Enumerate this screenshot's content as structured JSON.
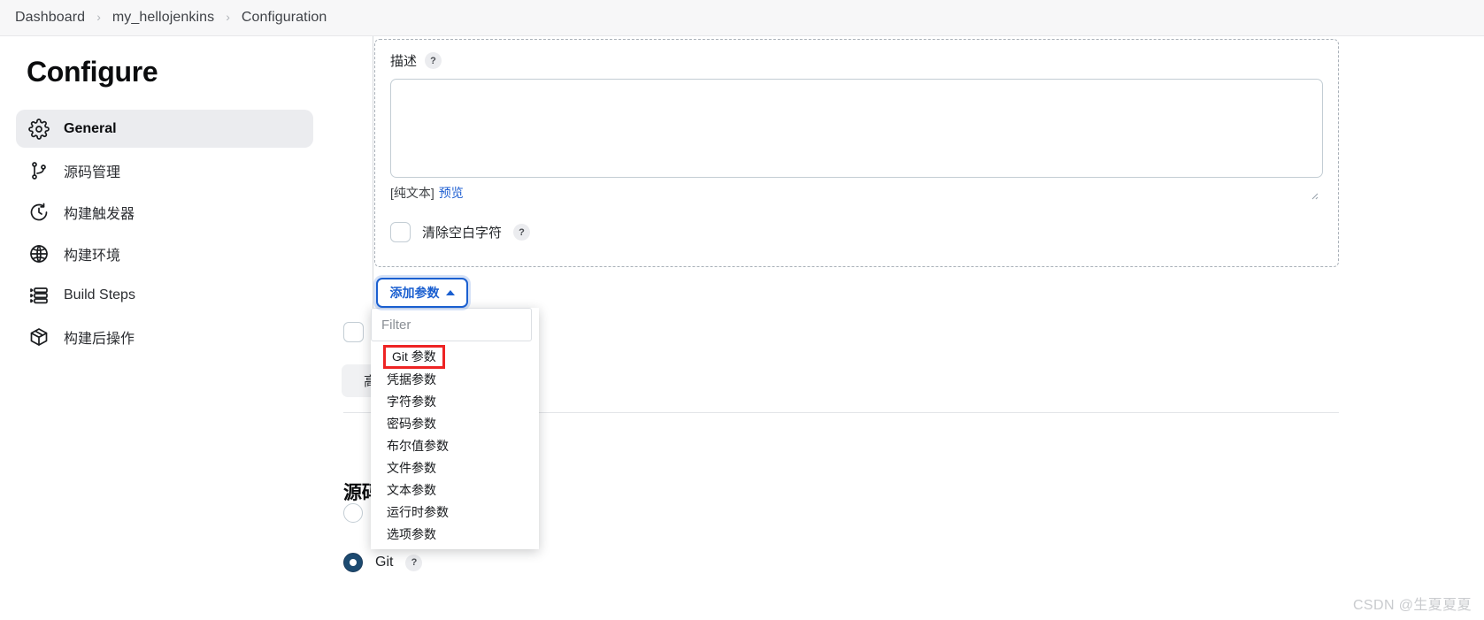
{
  "breadcrumb": {
    "items": [
      {
        "label": "Dashboard"
      },
      {
        "label": "my_hellojenkins"
      },
      {
        "label": "Configuration"
      }
    ],
    "separator": "›"
  },
  "sidebar": {
    "title": "Configure",
    "items": [
      {
        "label": "General",
        "icon": "gear-icon",
        "active": true
      },
      {
        "label": "源码管理",
        "icon": "branch-icon",
        "active": false
      },
      {
        "label": "构建触发器",
        "icon": "clock-icon",
        "active": false
      },
      {
        "label": "构建环境",
        "icon": "globe-icon",
        "active": false
      },
      {
        "label": "Build Steps",
        "icon": "list-icon",
        "active": false
      },
      {
        "label": "构建后操作",
        "icon": "package-icon",
        "active": false
      }
    ]
  },
  "parameter_block": {
    "description": {
      "label": "描述",
      "help": "?",
      "value": "",
      "placeholder": ""
    },
    "plaintext_note": "[纯文本]",
    "preview_link": "预览",
    "trim_whitespace": {
      "label": "清除空白字符",
      "help": "?",
      "checked": false
    }
  },
  "add_parameter": {
    "button_label": "添加参数",
    "expanded": true,
    "filter_placeholder": "Filter",
    "filter_value": "",
    "highlight_color": "#ee2424",
    "options": [
      {
        "label": "Git 参数",
        "highlighted": true
      },
      {
        "label": "凭据参数",
        "highlighted": false
      },
      {
        "label": "字符参数",
        "highlighted": false
      },
      {
        "label": "密码参数",
        "highlighted": false
      },
      {
        "label": "布尔值参数",
        "highlighted": false
      },
      {
        "label": "文件参数",
        "highlighted": false
      },
      {
        "label": "文本参数",
        "highlighted": false
      },
      {
        "label": "运行时参数",
        "highlighted": false
      },
      {
        "label": "选项参数",
        "highlighted": false
      }
    ]
  },
  "advanced_button": {
    "label": "高级"
  },
  "scm_section": {
    "heading": "源码管理",
    "options": [
      {
        "label": "",
        "checked": false
      },
      {
        "label": "Git",
        "help": "?",
        "checked": true
      }
    ]
  },
  "watermark": "CSDN @生夏夏夏",
  "colors": {
    "accent": "#1a5fd0",
    "link": "#1f5fd1",
    "highlight": "#ee2424",
    "radio_selected": "#1c4a70",
    "sidebar_active_bg": "#ebecef"
  }
}
